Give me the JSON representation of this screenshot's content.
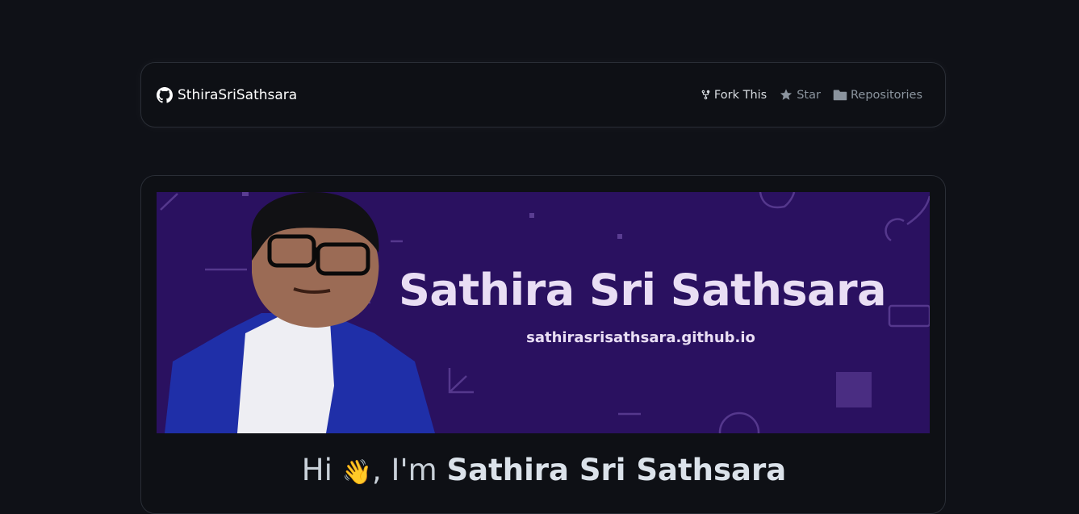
{
  "navbar": {
    "brand": "SthiraSriSathsara",
    "links": [
      {
        "label": "Fork This",
        "icon": "fork-icon"
      },
      {
        "label": "Star",
        "icon": "star-icon"
      },
      {
        "label": "Repositories",
        "icon": "folder-icon"
      }
    ]
  },
  "banner": {
    "title": "Sathira Sri Sathsara",
    "url": "sathirasrisathsara.github.io",
    "background": "#2a1160"
  },
  "intro": {
    "prefix": "Hi ",
    "emoji": "👋",
    "middle": ", I'm ",
    "name": "Sathira Sri Sathsara"
  },
  "colors": {
    "page_bg": "#0f1117",
    "card_border": "#2a2e36",
    "muted_text": "#8b949e"
  }
}
